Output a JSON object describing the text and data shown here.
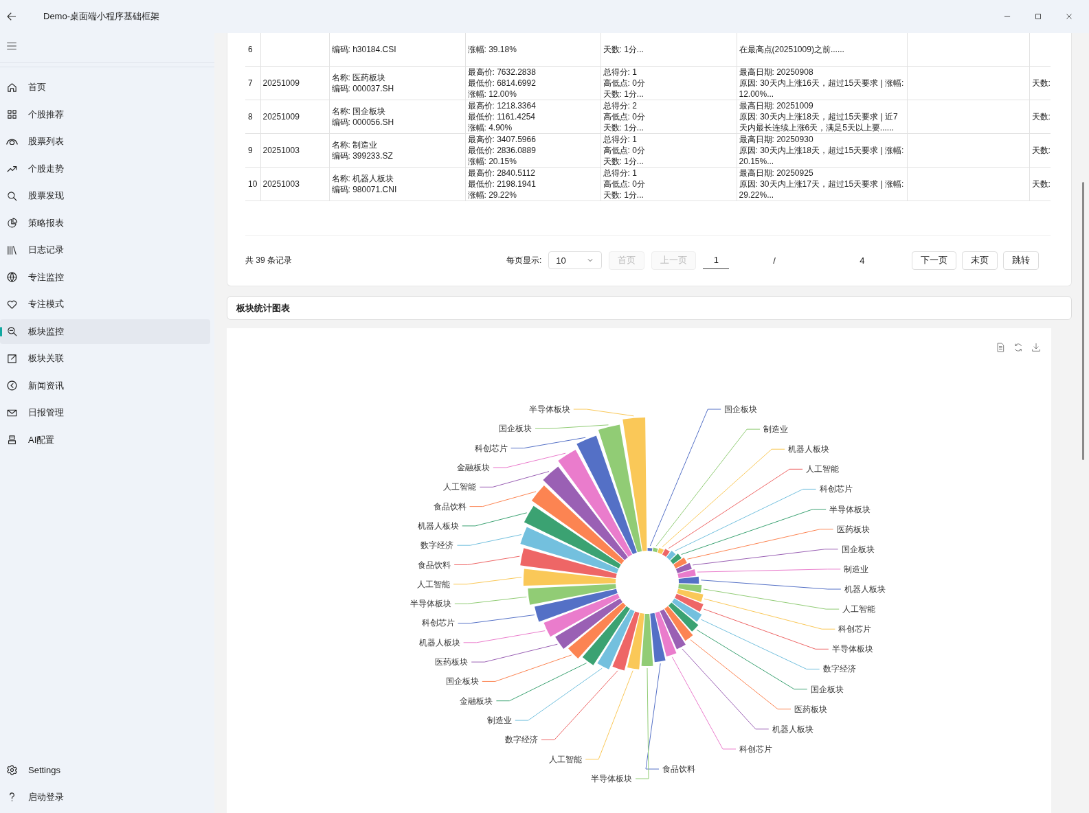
{
  "window": {
    "title": "Demo-桌面端小程序基础框架"
  },
  "sidebar": {
    "items": [
      {
        "label": "首页",
        "selected": false
      },
      {
        "label": "个股推荐",
        "selected": false
      },
      {
        "label": "股票列表",
        "selected": false
      },
      {
        "label": "个股走势",
        "selected": false
      },
      {
        "label": "股票发现",
        "selected": false
      },
      {
        "label": "策略报表",
        "selected": false
      },
      {
        "label": "日志记录",
        "selected": false
      },
      {
        "label": "专注监控",
        "selected": false
      },
      {
        "label": "专注模式",
        "selected": false
      },
      {
        "label": "板块监控",
        "selected": true
      },
      {
        "label": "板块关联",
        "selected": false
      },
      {
        "label": "新闻资讯",
        "selected": false
      },
      {
        "label": "日报管理",
        "selected": false
      },
      {
        "label": "AI配置",
        "selected": false
      }
    ],
    "footer_items": [
      {
        "label": "Settings"
      },
      {
        "label": "启动登录"
      }
    ]
  },
  "table": {
    "rows": [
      {
        "index": "6",
        "name_code": [
          "编码: h30184.CSI"
        ],
        "prices": [
          "涨幅: 39.18%"
        ],
        "score": [
          "天数: 1分..."
        ],
        "reason": [
          "在最高点(20251009)之前......"
        ]
      },
      {
        "index": "7",
        "date": "20251009",
        "name_code": [
          "名称: 医药板块",
          "编码: 000037.SH"
        ],
        "prices": [
          "最高价: 7632.2838",
          "最低价: 6814.6992",
          "涨幅: 12.00%"
        ],
        "score": [
          "总得分: 1",
          "高低点: 0分",
          "天数: 1分..."
        ],
        "reason": [
          "最高日期: 20250908",
          "原因: 30天内上涨16天，超过15天要求 | 涨幅: 12.00%..."
        ],
        "column_8": "天数:"
      },
      {
        "index": "8",
        "date": "20251009",
        "name_code": [
          "名称: 国企板块",
          "编码: 000056.SH"
        ],
        "prices": [
          "最高价: 1218.3364",
          "最低价: 1161.4254",
          "涨幅: 4.90%"
        ],
        "score": [
          "总得分: 2",
          "高低点: 0分",
          "天数: 1分..."
        ],
        "reason": [
          "最高日期: 20251009",
          "原因: 30天内上涨18天，超过15天要求 | 近7天内最长连续上涨6天，满足5天以上要......"
        ],
        "column_8": "天数:"
      },
      {
        "index": "9",
        "date": "20251003",
        "name_code": [
          "名称: 制造业",
          "编码: 399233.SZ"
        ],
        "prices": [
          "最高价: 3407.5966",
          "最低价: 2836.0889",
          "涨幅: 20.15%"
        ],
        "score": [
          "总得分: 1",
          "高低点: 0分",
          "天数: 1分..."
        ],
        "reason": [
          "最高日期: 20250930",
          "原因: 30天内上涨18天，超过15天要求 | 涨幅: 20.15%..."
        ],
        "column_8": "天数:"
      },
      {
        "index": "10",
        "date": "20251003",
        "name_code": [
          "名称: 机器人板块",
          "编码: 980071.CNI"
        ],
        "prices": [
          "最高价: 2840.5112",
          "最低价: 2198.1941",
          "涨幅: 29.22%"
        ],
        "score": [
          "总得分: 1",
          "高低点: 0分",
          "天数: 1分..."
        ],
        "reason": [
          "最高日期: 20250925",
          "原因: 30天内上涨17天，超过15天要求 | 涨幅: 29.22%..."
        ],
        "column_8": "天数:"
      }
    ]
  },
  "pagination": {
    "total": "共 39 条记录",
    "page_size_label": "每页显示:",
    "page_size": "10",
    "first_buttons": [
      {
        "label": "首页",
        "disabled": true
      },
      {
        "label": "上一页",
        "disabled": true
      }
    ],
    "page_input": "1",
    "separator": "/",
    "page_count": "4",
    "next_buttons": [
      {
        "label": "下一页",
        "disabled": false
      },
      {
        "label": "末页",
        "disabled": false
      },
      {
        "label": "跳转",
        "disabled": false
      }
    ]
  },
  "chart": {
    "title": "板块统计图表",
    "left_labels": [
      "半导体板块",
      "国企板块",
      "科创芯片",
      "金融板块",
      "人工智能",
      "食品饮料",
      "机器人板块",
      "数字经济",
      "食品饮料",
      "人工智能",
      "半导体板块",
      "科创芯片",
      "机器人板块",
      "医药板块",
      "国企板块",
      "金融板块",
      "制造业",
      "数字经济",
      "人工智能",
      "半导体板块"
    ],
    "right_labels": [
      "国企板块",
      "制造业",
      "机器人板块",
      "人工智能",
      "科创芯片",
      "半导体板块",
      "医药板块",
      "国企板块",
      "制造业",
      "机器人板块",
      "人工智能",
      "科创芯片",
      "半导体板块",
      "数字经济",
      "国企板块",
      "医药板块",
      "机器人板块",
      "科创芯片",
      "食品饮料"
    ]
  }
}
